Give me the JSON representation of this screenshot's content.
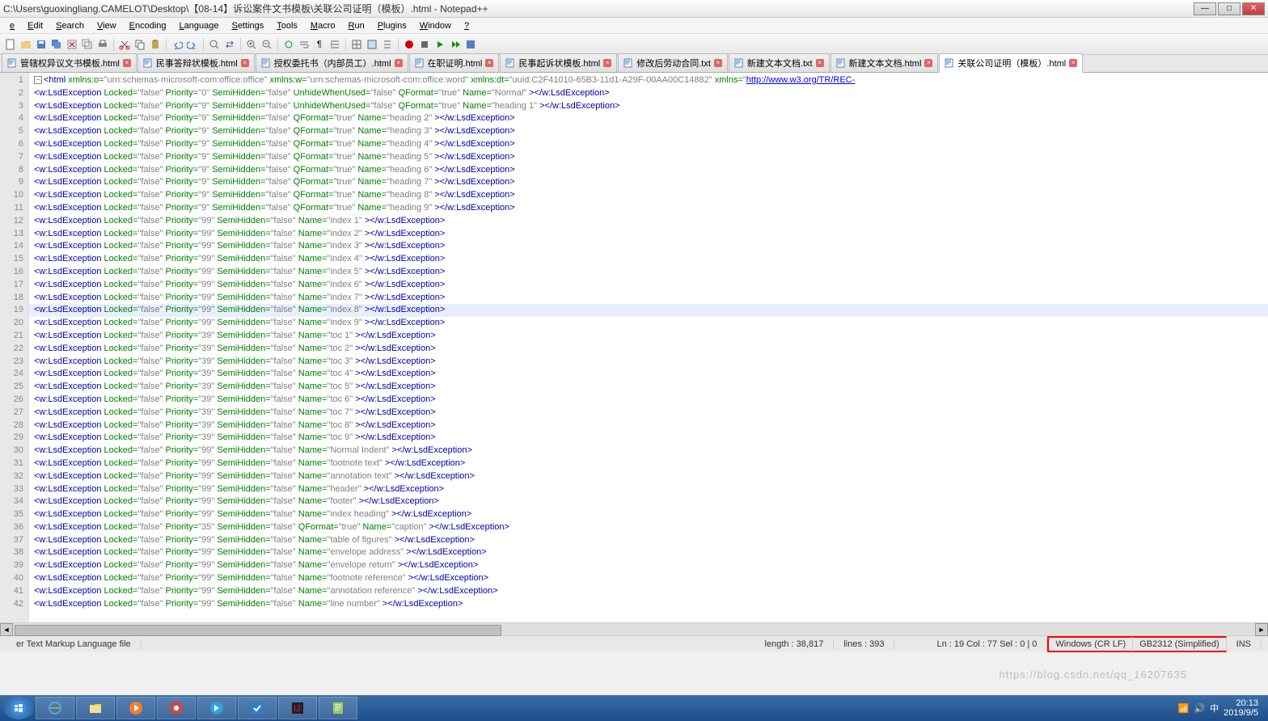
{
  "title": "C:\\Users\\guoxingliang.CAMELOT\\Desktop\\【08-14】诉讼案件文书模板\\关联公司证明（模板）.html - Notepad++",
  "menus": [
    "e",
    "Edit",
    "Search",
    "View",
    "Encoding",
    "Language",
    "Settings",
    "Tools",
    "Macro",
    "Run",
    "Plugins",
    "Window",
    "?"
  ],
  "tabs": [
    {
      "label": "管辖权异议文书模板.html",
      "active": false
    },
    {
      "label": "民事答辩状模板.html",
      "active": false
    },
    {
      "label": "授权委托书（内部员工）.html",
      "active": false
    },
    {
      "label": "在职证明.html",
      "active": false
    },
    {
      "label": "民事起诉状模板.html",
      "active": false
    },
    {
      "label": "修改后劳动合同.txt",
      "active": false
    },
    {
      "label": "新建文本文档.txt",
      "active": false
    },
    {
      "label": "新建文本文档.html",
      "active": false
    },
    {
      "label": "关联公司证明（模板）.html",
      "active": true
    }
  ],
  "xmlns_o": "urn:schemas-microsoft-com:office:office",
  "xmlns_w": "urn:schemas-microsoft-com:office:word",
  "xmlns_dt": "uuid:C2F41010-65B3-11d1-A29F-00AA00C14882",
  "xmlns_url": "http://www.w3.org/TR/REC-",
  "lines": [
    {
      "n": 2,
      "p": "0",
      "sh": "false",
      "u": true,
      "uw": "false",
      "q": true,
      "qv": "true",
      "name": "Normal"
    },
    {
      "n": 3,
      "p": "9",
      "sh": "false",
      "u": true,
      "uw": "false",
      "q": true,
      "qv": "true",
      "name": "heading 1"
    },
    {
      "n": 4,
      "p": "9",
      "sh": "false",
      "q": true,
      "qv": "true",
      "name": "heading 2"
    },
    {
      "n": 5,
      "p": "9",
      "sh": "false",
      "q": true,
      "qv": "true",
      "name": "heading 3"
    },
    {
      "n": 6,
      "p": "9",
      "sh": "false",
      "q": true,
      "qv": "true",
      "name": "heading 4"
    },
    {
      "n": 7,
      "p": "9",
      "sh": "false",
      "q": true,
      "qv": "true",
      "name": "heading 5"
    },
    {
      "n": 8,
      "p": "9",
      "sh": "false",
      "q": true,
      "qv": "true",
      "name": "heading 6"
    },
    {
      "n": 9,
      "p": "9",
      "sh": "false",
      "q": true,
      "qv": "true",
      "name": "heading 7"
    },
    {
      "n": 10,
      "p": "9",
      "sh": "false",
      "q": true,
      "qv": "true",
      "name": "heading 8"
    },
    {
      "n": 11,
      "p": "9",
      "sh": "false",
      "q": true,
      "qv": "true",
      "name": "heading 9"
    },
    {
      "n": 12,
      "p": "99",
      "sh": "false",
      "name": "index 1"
    },
    {
      "n": 13,
      "p": "99",
      "sh": "false",
      "name": "index 2"
    },
    {
      "n": 14,
      "p": "99",
      "sh": "false",
      "name": "index 3"
    },
    {
      "n": 15,
      "p": "99",
      "sh": "false",
      "name": "index 4"
    },
    {
      "n": 16,
      "p": "99",
      "sh": "false",
      "name": "index 5"
    },
    {
      "n": 17,
      "p": "99",
      "sh": "false",
      "name": "index 6"
    },
    {
      "n": 18,
      "p": "99",
      "sh": "false",
      "name": "index 7"
    },
    {
      "n": 19,
      "p": "99",
      "sh": "false",
      "name": "index 8",
      "hl": true
    },
    {
      "n": 20,
      "p": "99",
      "sh": "false",
      "name": "index 9"
    },
    {
      "n": 21,
      "p": "39",
      "sh": "false",
      "name": "toc 1"
    },
    {
      "n": 22,
      "p": "39",
      "sh": "false",
      "name": "toc 2"
    },
    {
      "n": 23,
      "p": "39",
      "sh": "false",
      "name": "toc 3"
    },
    {
      "n": 24,
      "p": "39",
      "sh": "false",
      "name": "toc 4"
    },
    {
      "n": 25,
      "p": "39",
      "sh": "false",
      "name": "toc 5"
    },
    {
      "n": 26,
      "p": "39",
      "sh": "false",
      "name": "toc 6"
    },
    {
      "n": 27,
      "p": "39",
      "sh": "false",
      "name": "toc 7"
    },
    {
      "n": 28,
      "p": "39",
      "sh": "false",
      "name": "toc 8"
    },
    {
      "n": 29,
      "p": "39",
      "sh": "false",
      "name": "toc 9"
    },
    {
      "n": 30,
      "p": "99",
      "sh": "false",
      "name": "Normal Indent"
    },
    {
      "n": 31,
      "p": "99",
      "sh": "false",
      "name": "footnote text"
    },
    {
      "n": 32,
      "p": "99",
      "sh": "false",
      "name": "annotation text"
    },
    {
      "n": 33,
      "p": "99",
      "sh": "false",
      "name": "header"
    },
    {
      "n": 34,
      "p": "99",
      "sh": "false",
      "name": "footer"
    },
    {
      "n": 35,
      "p": "99",
      "sh": "false",
      "name": "index heading"
    },
    {
      "n": 36,
      "p": "35",
      "sh": "false",
      "q": true,
      "qv": "true",
      "name": "caption"
    },
    {
      "n": 37,
      "p": "99",
      "sh": "false",
      "name": "table of figures"
    },
    {
      "n": 38,
      "p": "99",
      "sh": "false",
      "name": "envelope address"
    },
    {
      "n": 39,
      "p": "99",
      "sh": "false",
      "name": "envelope return"
    },
    {
      "n": 40,
      "p": "99",
      "sh": "false",
      "name": "footnote reference"
    },
    {
      "n": 41,
      "p": "99",
      "sh": "false",
      "name": "annotation reference"
    },
    {
      "n": 42,
      "p": "99",
      "sh": "false",
      "name": "line number"
    }
  ],
  "status": {
    "filetype": "er Text Markup Language file",
    "length": "length : 38,817",
    "lines": "lines : 393",
    "pos": "Ln : 19   Col : 77   Sel : 0 | 0",
    "eol": "Windows (CR LF)",
    "enc": "GB2312 (Simplified)",
    "ins": "INS"
  },
  "watermark": "https://blog.csdn.net/qq_16207635",
  "clock": {
    "time": "20:13",
    "date": "2019/9/5"
  }
}
